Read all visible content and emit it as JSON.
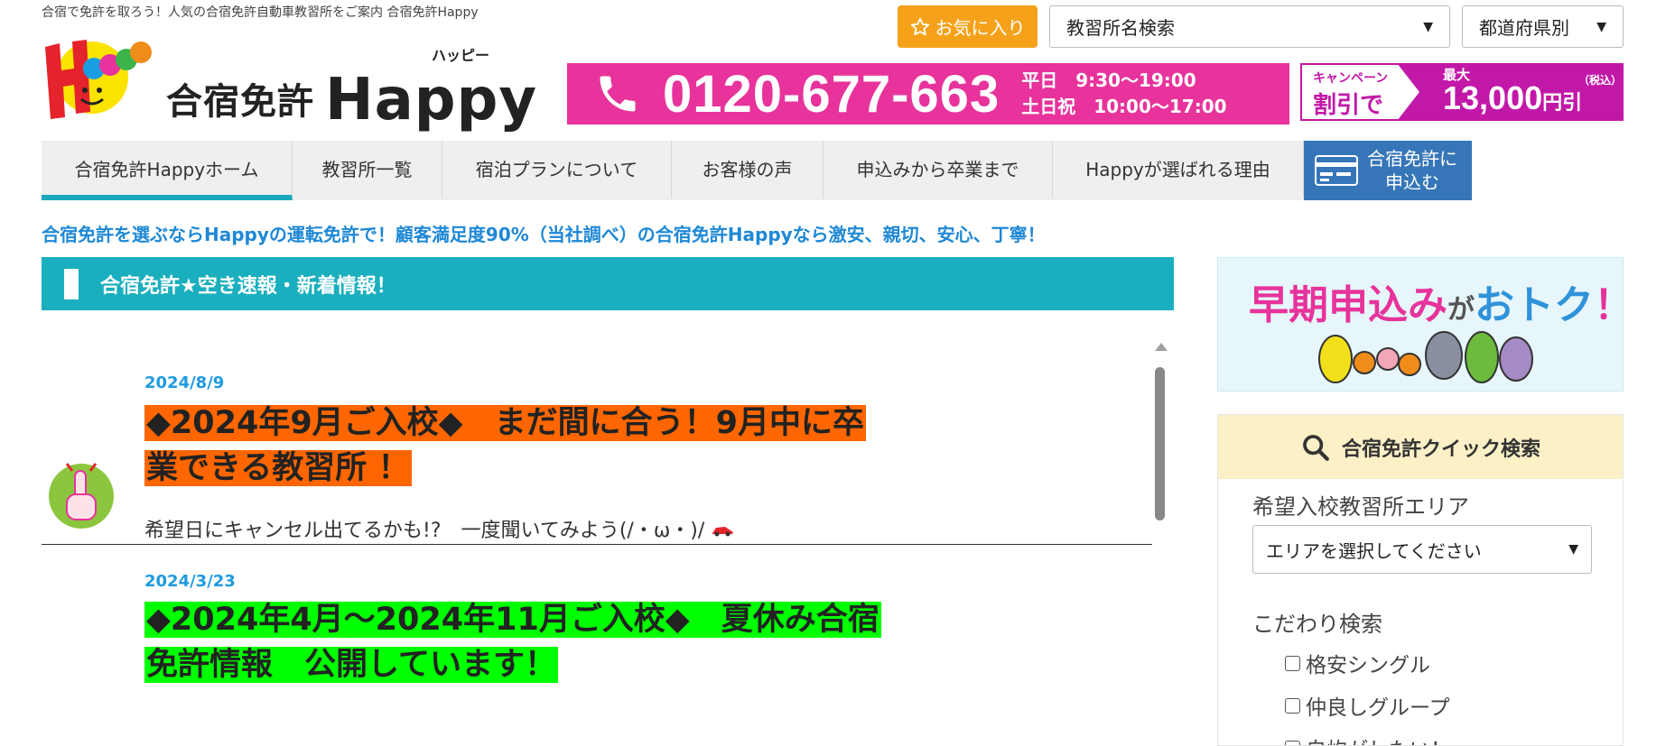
{
  "header": {
    "tagline": "合宿で免許を取ろう！人気の合宿免許自動車教習所をご案内 合宿免許Happy",
    "favorite_label": "お気に入り",
    "school_search_label": "教習所名検索",
    "prefecture_label": "都道府県別",
    "logo_text": "合宿免許",
    "logo_brand": "Happy",
    "logo_kana": "ハッピー",
    "phone_number": "0120-677-663",
    "hours_weekday": "平日　9:30～19:00",
    "hours_weekend": "土日祝　10:00～17:00",
    "campaign_line1": "キャンペーン",
    "campaign_line2": "割引で",
    "campaign_max": "最大",
    "campaign_tax": "（税込）",
    "campaign_amount": "13,000",
    "campaign_unit": "円引"
  },
  "nav": {
    "items": [
      {
        "label": "合宿免許Happyホーム"
      },
      {
        "label": "教習所一覧"
      },
      {
        "label": "宿泊プランについて"
      },
      {
        "label": "お客様の声"
      },
      {
        "label": "申込みから卒業まで"
      },
      {
        "label": "Happyが選ばれる理由"
      }
    ],
    "apply_line1": "合宿免許に",
    "apply_line2": "申込む"
  },
  "lead_text": "合宿免許を選ぶならHappyの運転免許で！顧客満足度90%（当社調べ）の合宿免許Happyなら激安、親切、安心、丁寧！",
  "news": {
    "section_title": "合宿免許★空き速報・新着情報！",
    "items": [
      {
        "date": "2024/8/9",
        "title_line1": "◆2024年9月ご入校◆　まだ間に合う！9月中に卒",
        "title_line2": "業できる教習所 ！",
        "body": "希望日にキャンセル出てるかも!?　一度聞いてみよう(/・ω・)/"
      },
      {
        "date": "2024/3/23",
        "title_line1": "◆2024年4月～2024年11月ご入校◆　夏休み合宿",
        "title_line2": "免許情報　公開しています！"
      }
    ]
  },
  "sidebar": {
    "banner": {
      "part1": "早期申込み",
      "part2": "が",
      "part3": "おトク",
      "part4": "！"
    },
    "quick_search": {
      "title": "合宿免許クイック検索",
      "area_label": "希望入校教習所エリア",
      "area_select": "エリアを選択してください",
      "kodawari_label": "こだわり検索",
      "options": [
        "格安シングル",
        "仲良しグループ",
        "自炊がしたい！"
      ]
    }
  },
  "colors": {
    "accent_teal": "#1aafbe",
    "phone_pink": "#e7339b",
    "campaign_magenta": "#c218a8",
    "apply_blue": "#3676b8",
    "highlight_orange": "#ff6600",
    "highlight_green": "#00ff00",
    "link_blue": "#1e88d6"
  }
}
